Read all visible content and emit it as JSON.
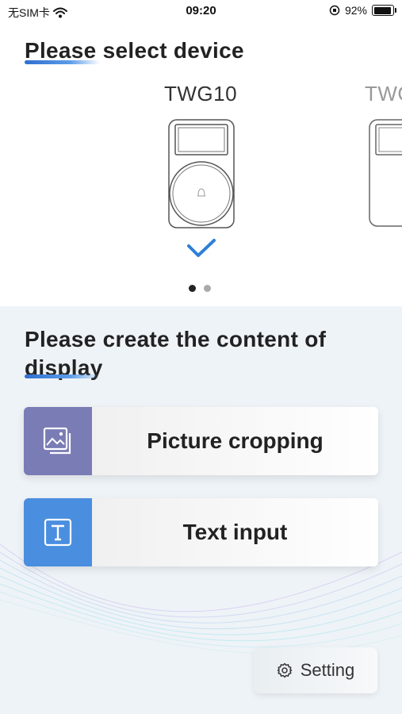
{
  "status": {
    "carrier": "无SIM卡",
    "time": "09:20",
    "battery": "92%",
    "battery_level": 0.92
  },
  "select_section": {
    "title": "Please select device"
  },
  "devices": [
    {
      "name": "TWG10",
      "selected": true
    },
    {
      "name": "TWG",
      "selected": false
    }
  ],
  "pager": {
    "total": 2,
    "active": 0
  },
  "create_section": {
    "title_line1": "Please create the content of",
    "title_line2": "display"
  },
  "actions": {
    "picture_cropping": "Picture cropping",
    "text_input": "Text input",
    "setting": "Setting"
  },
  "colors": {
    "accent": "#2f7fd6",
    "picture_icon_bg": "#7a7cb5",
    "text_icon_bg": "#4a8ee0",
    "lower_bg": "#eef3f7"
  },
  "icons": {
    "picture": "picture-icon",
    "text": "text-icon",
    "setting": "gear-icon",
    "check": "checkmark-icon"
  }
}
